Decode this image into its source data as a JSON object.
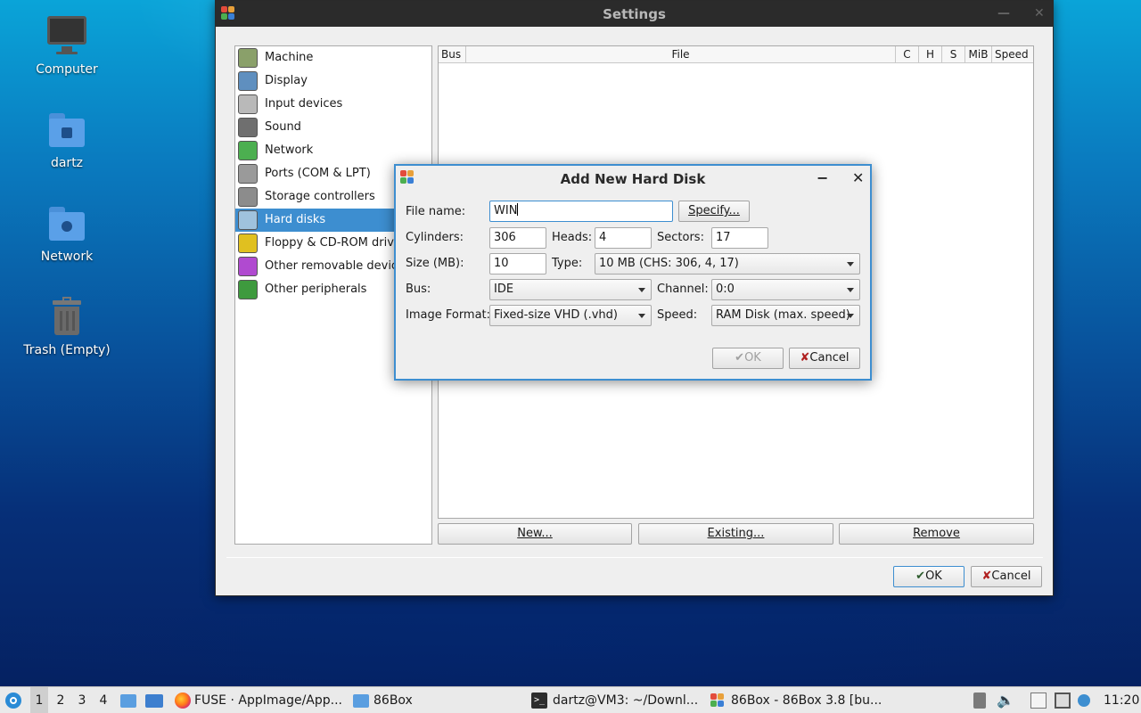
{
  "desktop": {
    "icons": [
      {
        "label": "Computer",
        "icon": "computer-icon"
      },
      {
        "label": "dartz",
        "icon": "home-folder-icon"
      },
      {
        "label": "Network",
        "icon": "network-folder-icon"
      },
      {
        "label": "Trash (Empty)",
        "icon": "trash-icon"
      }
    ]
  },
  "settings": {
    "title": "Settings",
    "categories": [
      {
        "label": "Machine",
        "icon": "machine-icon",
        "color": "#8aa06a"
      },
      {
        "label": "Display",
        "icon": "display-icon",
        "color": "#5f8fbf"
      },
      {
        "label": "Input devices",
        "icon": "input-devices-icon",
        "color": "#b9b9b9"
      },
      {
        "label": "Sound",
        "icon": "sound-icon",
        "color": "#6f6f6f"
      },
      {
        "label": "Network",
        "icon": "network-icon",
        "color": "#4caf50"
      },
      {
        "label": "Ports (COM & LPT)",
        "icon": "ports-icon",
        "color": "#9a9a9a"
      },
      {
        "label": "Storage controllers",
        "icon": "storage-controllers-icon",
        "color": "#8c8c8c"
      },
      {
        "label": "Hard disks",
        "icon": "hard-disk-icon",
        "color": "#9fc2dd"
      },
      {
        "label": "Floppy & CD-ROM drives",
        "icon": "floppy-cdrom-icon",
        "color": "#e0c020"
      },
      {
        "label": "Other removable devices",
        "icon": "removable-devices-icon",
        "color": "#b04ad0"
      },
      {
        "label": "Other peripherals",
        "icon": "peripherals-icon",
        "color": "#3e9a3e"
      }
    ],
    "selected_category": "Hard disks",
    "table_columns": [
      "Bus",
      "File",
      "C",
      "H",
      "S",
      "MiB",
      "Speed"
    ],
    "buttons": {
      "new": "New...",
      "existing": "Existing...",
      "remove": "Remove",
      "ok": "OK",
      "cancel": "Cancel"
    }
  },
  "dialog": {
    "title": "Add New Hard Disk",
    "file_name_label": "File name:",
    "file_name_value": "WIN",
    "specify_button": "Specify...",
    "cylinders_label": "Cylinders:",
    "cylinders_value": "306",
    "heads_label": "Heads:",
    "heads_value": "4",
    "sectors_label": "Sectors:",
    "sectors_value": "17",
    "size_label": "Size (MB):",
    "size_value": "10",
    "type_label": "Type:",
    "type_value": "10 MB (CHS: 306, 4, 17)",
    "bus_label": "Bus:",
    "bus_value": "IDE",
    "channel_label": "Channel:",
    "channel_value": "0:0",
    "image_format_label": "Image Format:",
    "image_format_value": "Fixed-size VHD (.vhd)",
    "speed_label": "Speed:",
    "speed_value": "RAM Disk (max. speed)",
    "ok_button": "OK",
    "cancel_button": "Cancel",
    "minimize_symbol": "−",
    "close_symbol": "✕"
  },
  "taskbar": {
    "workspaces": [
      "1",
      "2",
      "3",
      "4"
    ],
    "active_workspace": "1",
    "tasks": [
      {
        "label": "FUSE · AppImage/App...",
        "icon": "firefox-icon"
      },
      {
        "label": "86Box",
        "icon": "folder-icon"
      },
      {
        "label": "dartz@VM3: ~/Downl...",
        "icon": "terminal-icon"
      },
      {
        "label": "86Box - 86Box 3.8 [bu...",
        "icon": "86box-icon"
      }
    ],
    "clock": "11:20"
  },
  "colors": {
    "accent": "#3d8ed0",
    "titlebar": "#2b2b2b"
  }
}
